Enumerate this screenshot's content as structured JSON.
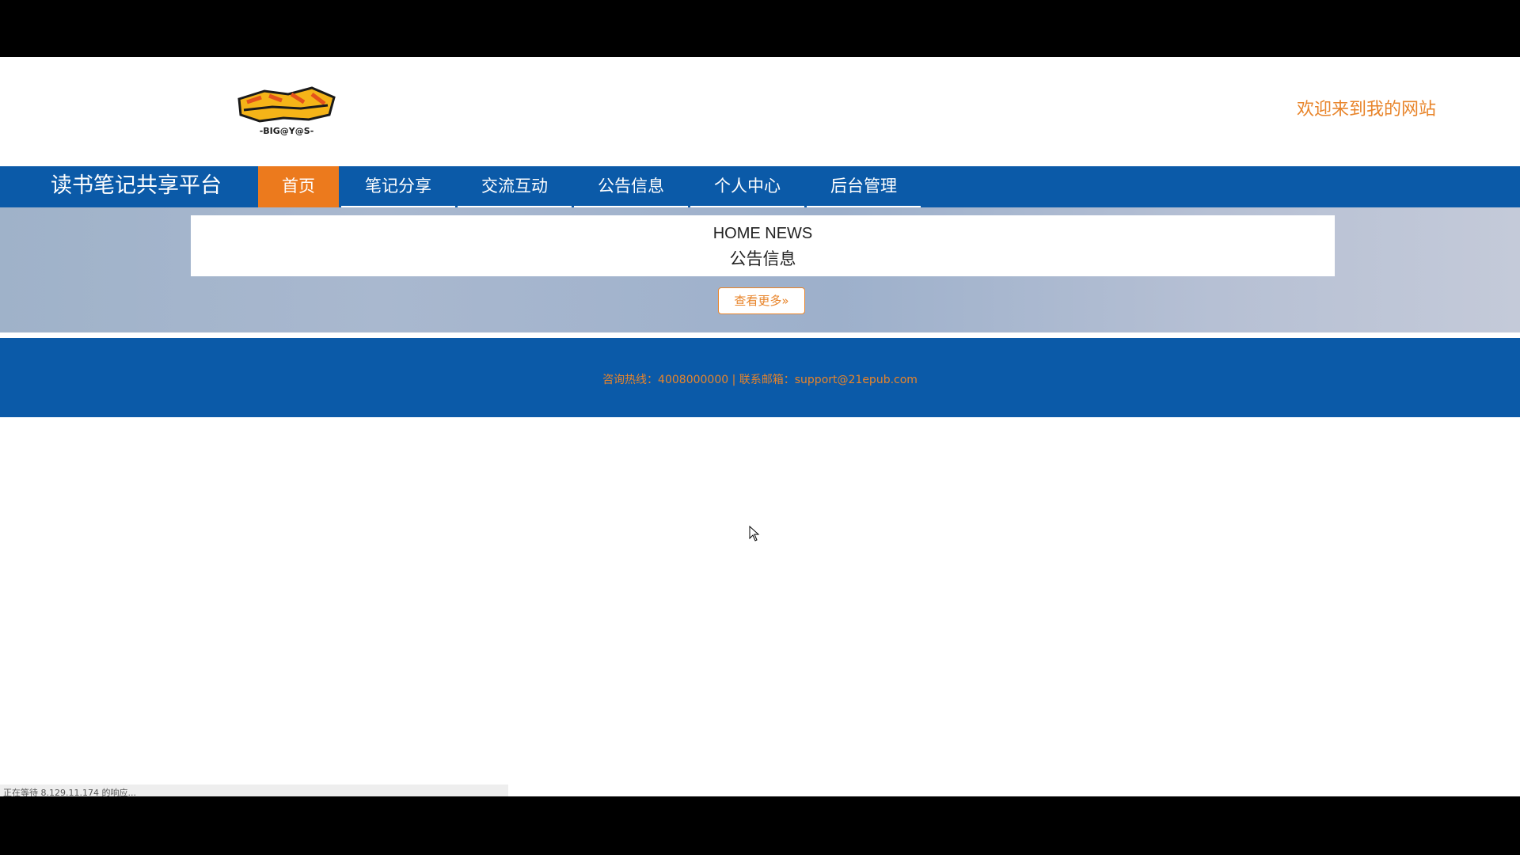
{
  "header": {
    "logo_text": "-BIG@Y@S-",
    "welcome": "欢迎来到我的网站"
  },
  "nav": {
    "site_title": "读书笔记共享平台",
    "items": [
      {
        "label": "首页",
        "active": true
      },
      {
        "label": "笔记分享",
        "active": false
      },
      {
        "label": "交流互动",
        "active": false
      },
      {
        "label": "公告信息",
        "active": false
      },
      {
        "label": "个人中心",
        "active": false
      },
      {
        "label": "后台管理",
        "active": false
      }
    ]
  },
  "news": {
    "title_en": "HOME NEWS",
    "title_cn": "公告信息",
    "more_button": "查看更多"
  },
  "footer": {
    "text": "咨询热线：4008000000 | 联系邮箱：support@21epub.com"
  },
  "status_bar": {
    "text": "正在等待 8.129.11.174 的响应..."
  },
  "colors": {
    "nav_bg": "#0b5aa8",
    "accent": "#ec7a1d",
    "footer_text": "#e8842a"
  }
}
